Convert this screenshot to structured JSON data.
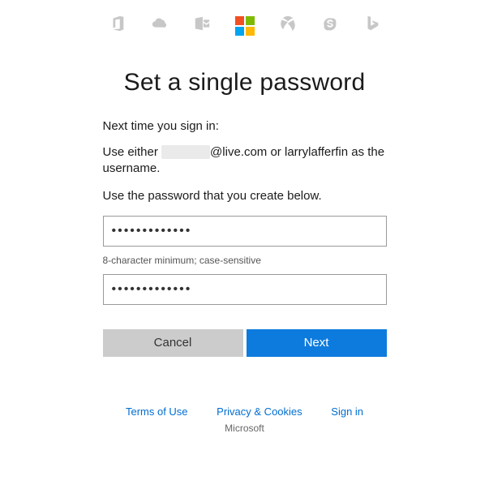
{
  "icons": {
    "office": "office-icon",
    "onedrive": "onedrive-icon",
    "outlook": "outlook-icon",
    "microsoft": "microsoft-logo-icon",
    "xbox": "xbox-icon",
    "skype": "skype-icon",
    "bing": "bing-icon"
  },
  "title": "Set a single password",
  "intro": "Next time you sign in:",
  "instruction_prefix": "Use either ",
  "masked_email_domain": "@live.com",
  "instruction_middle": " or ",
  "username_alt": "larrylafferfin",
  "instruction_suffix": " as the username.",
  "use_password_line": "Use the password that you create below.",
  "password_value": "•••••••••••••",
  "password_hint": "8-character minimum; case-sensitive",
  "confirm_value": "•••••••••••••",
  "buttons": {
    "cancel": "Cancel",
    "next": "Next"
  },
  "footer": {
    "terms": "Terms of Use",
    "privacy": "Privacy & Cookies",
    "signin": "Sign in",
    "brand": "Microsoft"
  }
}
